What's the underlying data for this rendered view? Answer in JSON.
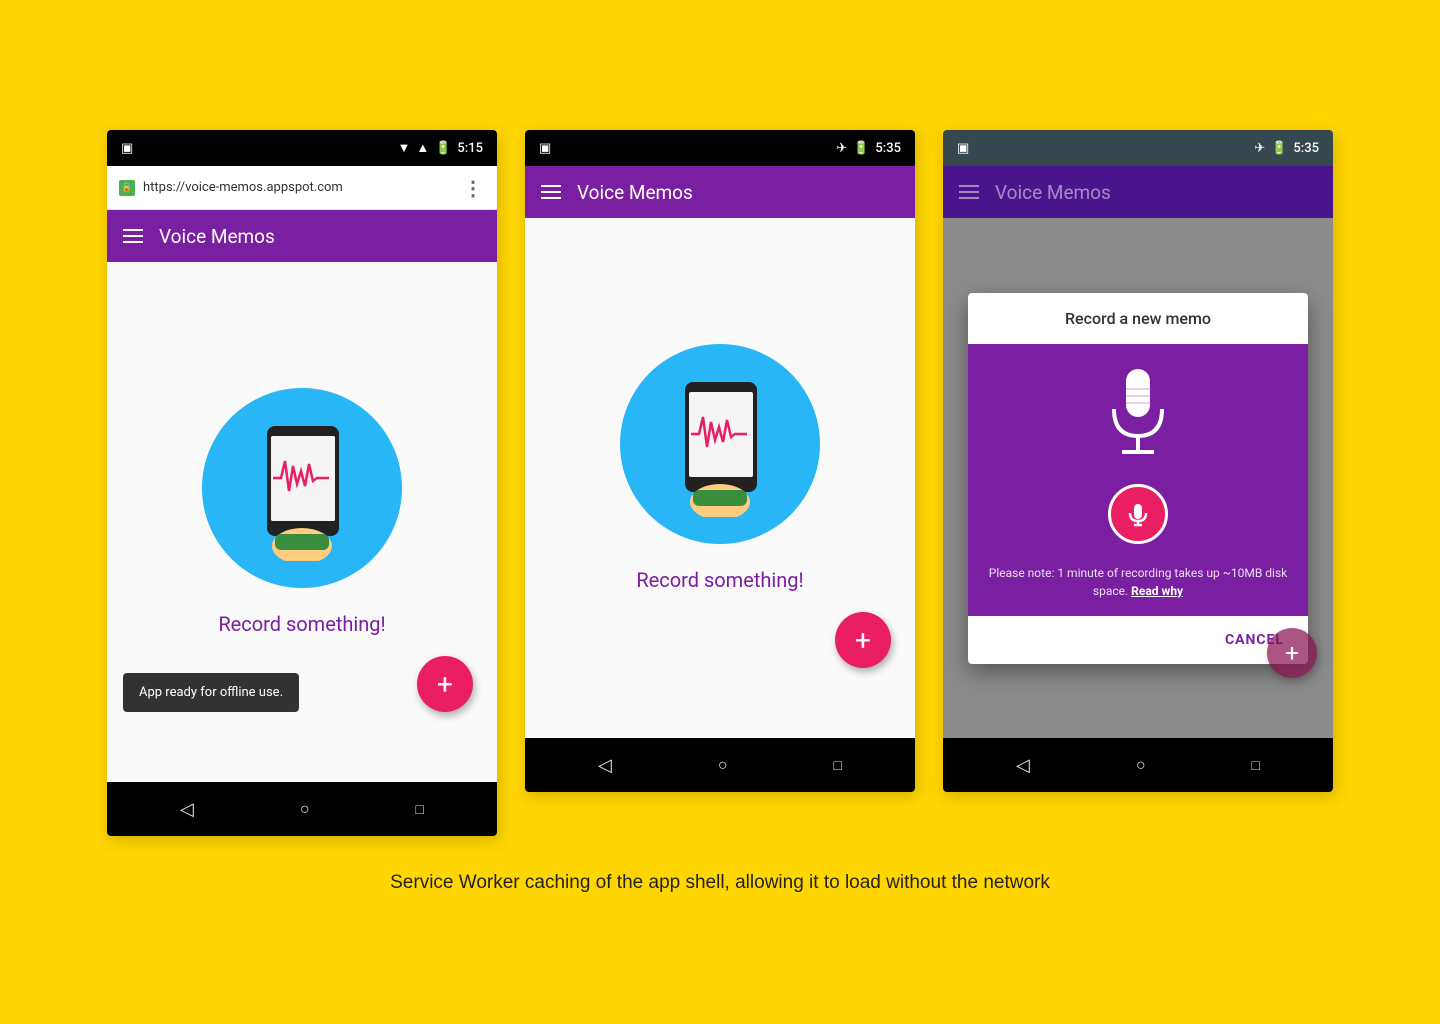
{
  "page": {
    "background": "#FFD600",
    "caption": "Service Worker caching of the app shell, allowing it to load without the network"
  },
  "phone1": {
    "status": {
      "left": "📱",
      "time": "5:15",
      "icons": "▼ ▲ 📶 🔋"
    },
    "url": "https://voice-memos.appspot.com",
    "app_title": "Voice Memos",
    "record_text": "Record something!",
    "fab_label": "+",
    "snackbar": "App ready for offline use.",
    "nav": [
      "◁",
      "○",
      "□"
    ]
  },
  "phone2": {
    "status": {
      "left": "📱",
      "time": "5:35",
      "icons": "✈ 🔋"
    },
    "app_title": "Voice Memos",
    "record_text": "Record something!",
    "fab_label": "+",
    "nav": [
      "◁",
      "○",
      "□"
    ]
  },
  "phone3": {
    "status": {
      "left": "📱",
      "time": "5:35",
      "icons": "✈ 🔋"
    },
    "app_title": "Voice Memos",
    "dialog": {
      "title": "Record a new memo",
      "note": "Please note: 1 minute of recording takes up ~10MB disk space.",
      "note_link": "Read why",
      "cancel": "CANCEL"
    },
    "fab_label": "+",
    "nav": [
      "◁",
      "○",
      "□"
    ]
  }
}
